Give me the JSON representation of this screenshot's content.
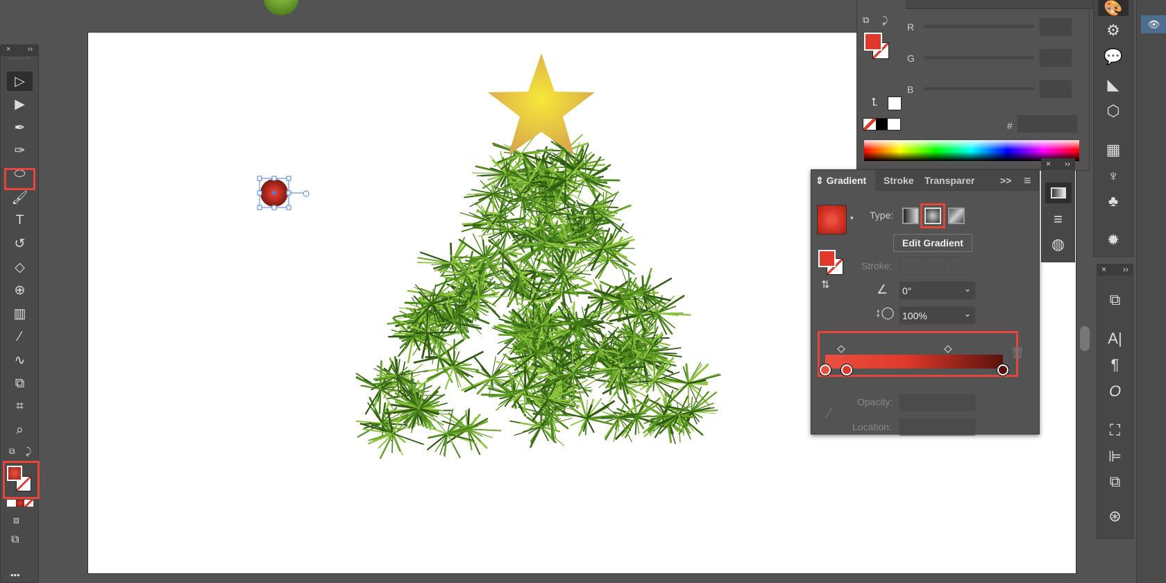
{
  "toolbar": {
    "close": "×",
    "expand": "››",
    "more": "•••",
    "tools": [
      {
        "name": "selection-tool",
        "glyph": "▷"
      },
      {
        "name": "direct-selection-tool",
        "glyph": "▶"
      },
      {
        "name": "pen-tool",
        "glyph": "✒"
      },
      {
        "name": "curvature-tool",
        "glyph": "✑"
      },
      {
        "name": "ellipse-tool",
        "glyph": "⬭"
      },
      {
        "name": "paintbrush-tool",
        "glyph": "🖌"
      },
      {
        "name": "type-tool",
        "glyph": "T"
      },
      {
        "name": "rotate-tool",
        "glyph": "↺"
      },
      {
        "name": "eraser-tool",
        "glyph": "◇"
      },
      {
        "name": "shape-builder-tool",
        "glyph": "⊕"
      },
      {
        "name": "gradient-tool",
        "glyph": "▥"
      },
      {
        "name": "eyedropper-tool",
        "glyph": "⁄"
      },
      {
        "name": "puppet-warp-tool",
        "glyph": "∿"
      },
      {
        "name": "blend-tool",
        "glyph": "⧉"
      },
      {
        "name": "artboard-tool",
        "glyph": "⌗"
      },
      {
        "name": "zoom-tool",
        "glyph": "⌕"
      }
    ]
  },
  "color_panel": {
    "r_label": "R",
    "g_label": "G",
    "b_label": "B",
    "hex_label": "#",
    "fill": "#e0392b"
  },
  "gradient_panel": {
    "tabs": [
      "Gradient",
      "Stroke",
      "Transparer"
    ],
    "overflow": ">>",
    "menu": "≡",
    "type_label": "Type:",
    "edit_button": "Edit Gradient",
    "stroke_label": "Stroke:",
    "angle": "0°",
    "aspect_ratio": "100%",
    "opacity_label": "Opacity:",
    "location_label": "Location:",
    "stops": [
      {
        "color": "#e8503f",
        "location": 0
      },
      {
        "color": "#e0392b",
        "location": 0.12
      },
      {
        "color": "#5a120c",
        "location": 1
      }
    ],
    "midpoints": [
      0.09,
      0.69
    ]
  },
  "small_panel": {
    "close": "×",
    "expand": "››"
  },
  "dock2": {
    "close": "×",
    "expand": "››"
  }
}
